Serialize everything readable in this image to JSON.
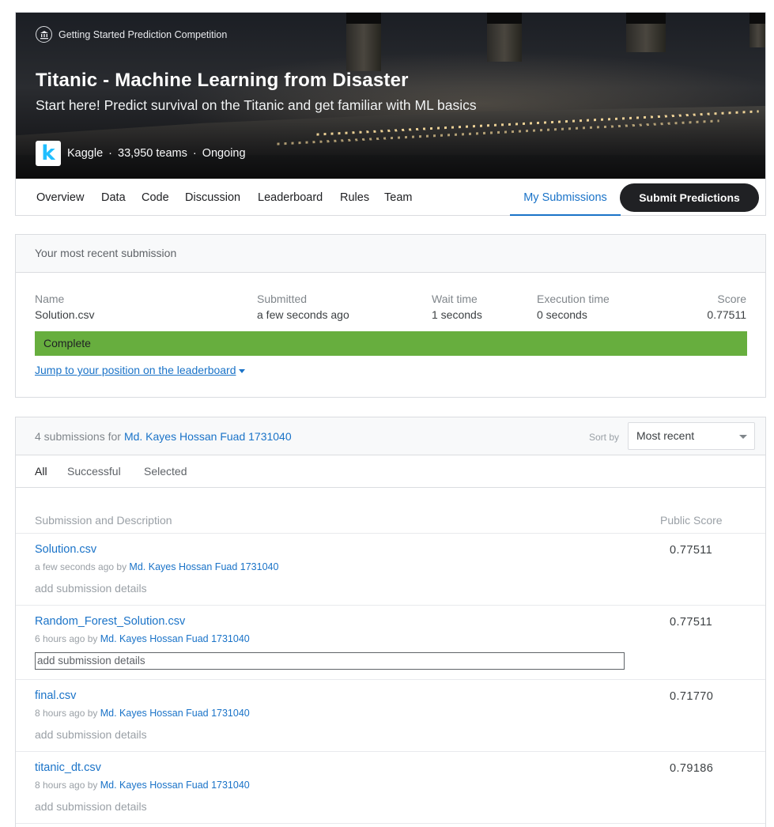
{
  "competition": {
    "type": "Getting Started Prediction Competition",
    "title": "Titanic - Machine Learning from Disaster",
    "subtitle": "Start here! Predict survival on the Titanic and get familiar with ML basics",
    "host": "Kaggle",
    "teams": "33,950 teams",
    "status": "Ongoing",
    "dot": "·"
  },
  "nav": {
    "tabs": [
      "Overview",
      "Data",
      "Code",
      "Discussion",
      "Leaderboard",
      "Rules",
      "Team"
    ],
    "active_tab": "My Submissions",
    "submit_label": "Submit Predictions"
  },
  "recent": {
    "heading": "Your most recent submission",
    "columns": {
      "name": {
        "label": "Name",
        "value": "Solution.csv"
      },
      "submitted": {
        "label": "Submitted",
        "value": "a few seconds ago"
      },
      "wait": {
        "label": "Wait time",
        "value": "1 seconds"
      },
      "execution": {
        "label": "Execution time",
        "value": "0 seconds"
      },
      "score": {
        "label": "Score",
        "value": "0.77511"
      }
    },
    "status": "Complete",
    "jump_link": "Jump to your position on the leaderboard"
  },
  "submissions": {
    "count_text": "4 submissions for",
    "user": "Md. Kayes Hossan Fuad 1731040",
    "sort_label": "Sort by",
    "sort_value": "Most recent",
    "filters": [
      "All",
      "Successful",
      "Selected"
    ],
    "col_description": "Submission and Description",
    "col_score": "Public Score",
    "rows": [
      {
        "file": "Solution.csv",
        "when": "a few seconds ago by",
        "user": "Md. Kayes Hossan Fuad 1731040",
        "details": "add submission details",
        "score": "0.77511"
      },
      {
        "file": "Random_Forest_Solution.csv",
        "when": "6 hours ago by",
        "user": "Md. Kayes Hossan Fuad 1731040",
        "details": "add submission details",
        "score": "0.77511"
      },
      {
        "file": "final.csv",
        "when": "8 hours ago by",
        "user": "Md. Kayes Hossan Fuad 1731040",
        "details": "add submission details",
        "score": "0.71770"
      },
      {
        "file": "titanic_dt.csv",
        "when": "8 hours ago by",
        "user": "Md. Kayes Hossan Fuad 1731040",
        "details": "add submission details",
        "score": "0.79186"
      }
    ]
  },
  "colors": {
    "accent": "#1a73c8",
    "complete": "#67ae3e",
    "dark_button": "#202124",
    "kaggle": "#20beff"
  }
}
